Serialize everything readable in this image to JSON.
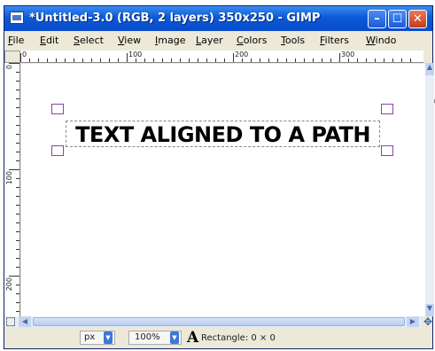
{
  "window": {
    "title": "*Untitled-3.0 (RGB, 2 layers) 350x250 - GIMP",
    "min_glyph": "–",
    "max_glyph": "☐",
    "close_glyph": "✕"
  },
  "menu": [
    "File",
    "Edit",
    "Select",
    "View",
    "Image",
    "Layer",
    "Colors",
    "Tools",
    "Filters",
    "Windo"
  ],
  "ruler": {
    "top_labels": [
      "0",
      "100",
      "200",
      "300"
    ],
    "left_labels": [
      "0",
      "100",
      "200"
    ]
  },
  "canvas": {
    "text_layer": "TEXT ALIGNED TO A PATH"
  },
  "statusbar": {
    "unit": "px",
    "zoom": "100%",
    "tool_glyph": "A",
    "status": "Rectangle: 0 × 0"
  },
  "colors": {
    "titlebar": "#0a5ad8",
    "handles": "#8a40b0",
    "close_button": "#c43c18"
  }
}
